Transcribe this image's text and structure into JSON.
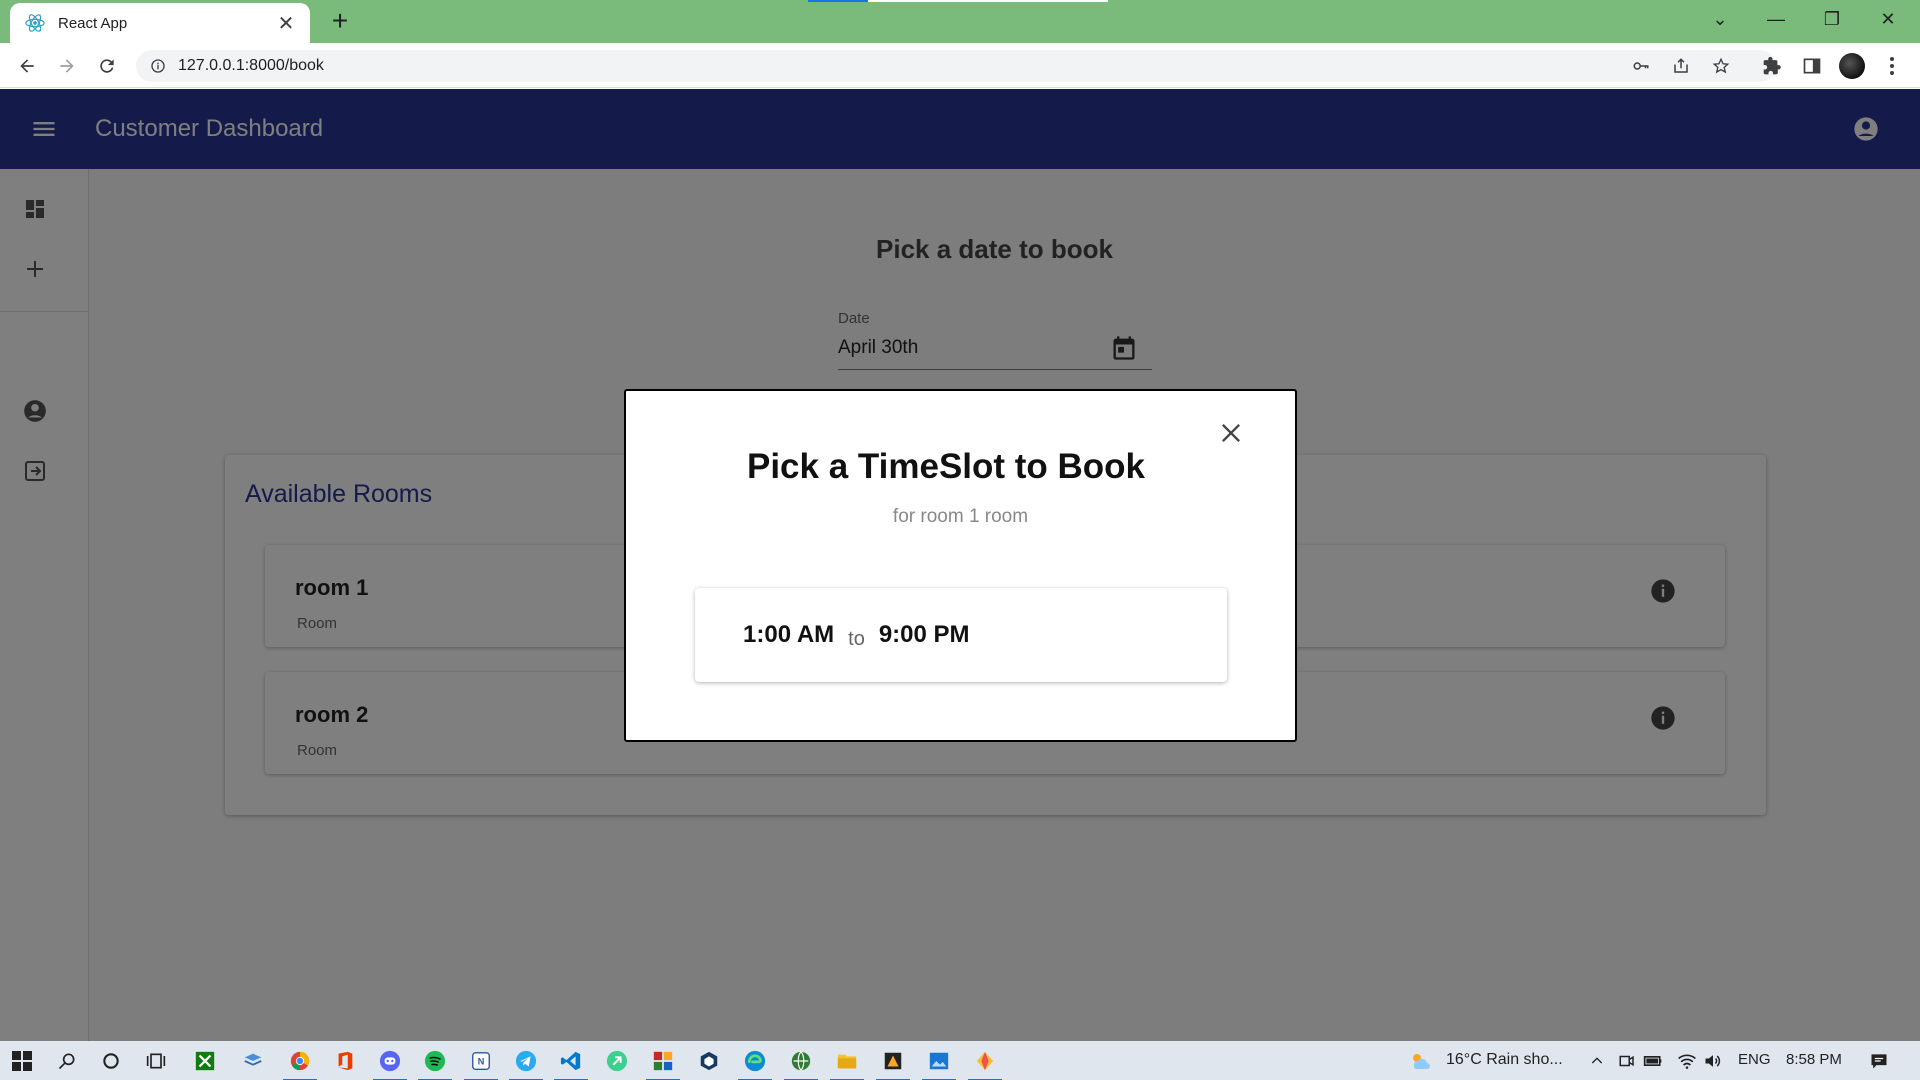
{
  "browser": {
    "tab_title": "React App",
    "url": "127.0.0.1:8000/book",
    "accent": "#7aba7a"
  },
  "appbar": {
    "title": "Customer Dashboard",
    "color": "#283593"
  },
  "main": {
    "heading": "Pick a date to book",
    "date_label": "Date",
    "date_value": "April 30th"
  },
  "rooms": {
    "title": "Available Rooms",
    "items": [
      {
        "name": "room 1",
        "type": "Room"
      },
      {
        "name": "room 2",
        "type": "Room"
      }
    ]
  },
  "modal": {
    "title": "Pick a TimeSlot to Book",
    "subtitle": "for room 1 room",
    "slot_start": "1:00 AM",
    "slot_sep": "to",
    "slot_end": "9:00 PM"
  },
  "taskbar": {
    "weather": "16°C  Rain sho...",
    "lang": "ENG",
    "time": "8:58 PM"
  }
}
